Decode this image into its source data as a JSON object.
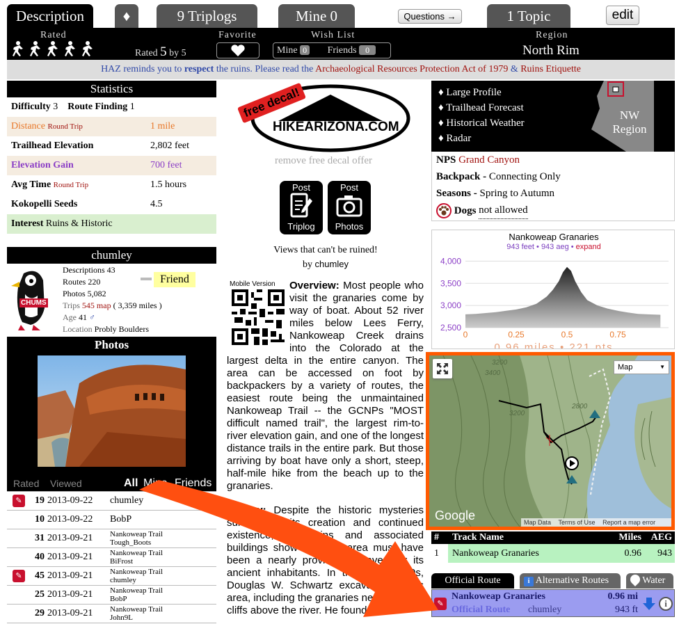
{
  "tabs": {
    "description": "Description",
    "diamond": "♦",
    "triplogs": "9 Triplogs",
    "mine": "Mine 0",
    "questions": "Questions →",
    "topic": "1 Topic",
    "edit": "edit"
  },
  "topbar": {
    "rated_label": "Rated",
    "rated_text": "Rated",
    "rated_value": "5",
    "rated_by": "by 5",
    "favorite_label": "Favorite",
    "wishlist_label": "Wish List",
    "mine_label": "Mine",
    "mine_count": "0",
    "friends_label": "Friends",
    "friends_count": "0",
    "region_label": "Region",
    "region_value": "North Rim"
  },
  "notice": {
    "p1": "HAZ reminds you to ",
    "p2": "respect",
    "p3": " the ruins. Please read the ",
    "p4": "Archaeological Resources Protection Act of 1979",
    "p5": " & ",
    "p6": "Ruins Etiquette"
  },
  "stats": {
    "title": "Statistics",
    "difficulty_label": "Difficulty",
    "difficulty": "3",
    "routefinding_label": "Route Finding",
    "routefinding": "1",
    "distance_label": "Distance",
    "distance_sub": "Round Trip",
    "distance": "1 mile",
    "trailhead_label": "Trailhead Elevation",
    "trailhead": "2,802 feet",
    "gain_label": "Elevation Gain",
    "gain": "700 feet",
    "avgtime_label": "Avg Time",
    "avgtime_sub": "Round Trip",
    "avgtime": "1.5 hours",
    "seeds_label": "Kokopelli Seeds",
    "seeds": "4.5",
    "interest_label": "Interest",
    "interest": "Ruins & Historic"
  },
  "user": {
    "name": "chumley",
    "descriptions": "Descriptions 43",
    "routes": "Routes 220",
    "photos": "Photos 5,082",
    "trips_label": "Trips",
    "trips_count": "545",
    "trips_map": "map",
    "trips_miles": "( 3,359 miles )",
    "age_label": "Age",
    "age": "41",
    "location_label": "Location",
    "location": "Probly Boulders",
    "friend": "Friend",
    "badge": "CHUMS"
  },
  "photos": {
    "title": "Photos"
  },
  "triplist": {
    "rated": "Rated",
    "viewed": "Viewed",
    "all": "All",
    "mine": "Mine",
    "friends": "Friends",
    "rows": [
      {
        "num": "19",
        "date": "2013-09-22",
        "title": "chumley",
        "sub": "",
        "icon": true
      },
      {
        "num": "10",
        "date": "2013-09-22",
        "title": "BobP",
        "sub": "",
        "icon": false
      },
      {
        "num": "31",
        "date": "2013-09-21",
        "title": "Nankoweap Trail",
        "sub": "Tough_Boots",
        "icon": false
      },
      {
        "num": "40",
        "date": "2013-09-21",
        "title": "Nankoweap Trail",
        "sub": "BiFrost",
        "icon": false
      },
      {
        "num": "45",
        "date": "2013-09-21",
        "title": "Nankoweap Trail",
        "sub": "chumley",
        "icon": true
      },
      {
        "num": "25",
        "date": "2013-09-21",
        "title": "Nankoweap Trail",
        "sub": "BobP",
        "icon": false
      },
      {
        "num": "29",
        "date": "2013-09-21",
        "title": "Nankoweap Trail",
        "sub": "John9L",
        "icon": false
      }
    ]
  },
  "decal": {
    "free": "free decal!",
    "site": "HIKEARIZONA.COM",
    "remove": "remove free decal offer"
  },
  "post": {
    "post1": "Post",
    "triplog": "Triplog",
    "post2": "Post",
    "photos": "Photos"
  },
  "tagline": {
    "line": "Views that can't be ruined!",
    "by": "by",
    "author": "chumley"
  },
  "mobile": "Mobile Version",
  "overview": {
    "title": "Overview:",
    "text": "Most people who visit the granaries come by way of boat. About 52 river miles below Lees Ferry, Nankoweap Creek drains into the Colorado at the largest delta in the entire canyon. The area can be accessed on foot by backpackers by a variety of routes, the easiest route being the unmaintained Nankoweap Trail -- the GCNPs \"MOST difficult named trail\", the largest rim-to-river elevation gain, and one of the longest distance trails in the entire park. But those arriving by boat have only a short, steep, half-mile hike from the beach up to the granaries.",
    "history_title": "History:",
    "history_text": "Despite the historic mysteries surrounding its creation and continued existence, the ruins and associated buildings show that this area must have been a nearly provided a haven for its ancient inhabitants. In the early 1900s, Douglas W. Schwartz excavated in this area, including the granaries nestled in the cliffs above the river. He found"
  },
  "links": {
    "items": [
      "Large Profile",
      "Trailhead Forecast",
      "Historical Weather",
      "Radar"
    ],
    "region": "NW Region"
  },
  "info": {
    "nps": "NPS",
    "park": "Grand Canyon",
    "backpack_label": "Backpack -",
    "backpack": "Connecting Only",
    "seasons_label": "Seasons -",
    "seasons": "Spring to Autumn",
    "dogs_label": "Dogs",
    "dogs": "not allowed"
  },
  "profile": {
    "title": "Nankoweap Granaries",
    "sub": "943 feet • 943 aeg •",
    "expand": "expand",
    "yticks": [
      "4,000",
      "3,500",
      "3,000",
      "2,500"
    ],
    "xticks": [
      "0",
      "0.25",
      "0.5",
      "0.75"
    ],
    "footer": "0.96 miles • 221 pts"
  },
  "map": {
    "type": "Map",
    "google": "Google",
    "mapdata": "Map Data",
    "terms": "Terms of Use",
    "report": "Report a map error",
    "labels": [
      "3200",
      "3400",
      "3200",
      "2800"
    ]
  },
  "tracks": {
    "h_num": "#",
    "h_name": "Track Name",
    "h_miles": "Miles",
    "h_aeg": "AEG",
    "rows": [
      {
        "num": "1",
        "name": "Nankoweap Granaries",
        "miles": "0.96",
        "aeg": "943"
      }
    ]
  },
  "routes": {
    "official": "Official Route",
    "alternative": "Alternative Routes",
    "water": "Water",
    "name": "Nankoweap Granaries",
    "type": "Official Route",
    "author": "chumley",
    "miles": "0.96 mi",
    "feet": "943 ft"
  },
  "chart_data": {
    "type": "area",
    "title": "Nankoweap Granaries",
    "xlabel": "",
    "ylabel": "",
    "xlim": [
      0,
      1
    ],
    "ylim": [
      2500,
      4100
    ],
    "x": [
      0,
      0.05,
      0.1,
      0.15,
      0.2,
      0.25,
      0.3,
      0.35,
      0.4,
      0.43,
      0.46,
      0.48,
      0.5,
      0.52,
      0.54,
      0.57,
      0.6,
      0.65,
      0.7,
      0.75,
      0.8,
      0.85,
      0.9,
      0.96
    ],
    "values": [
      2800,
      2810,
      2830,
      2850,
      2880,
      2910,
      2960,
      3040,
      3200,
      3350,
      3550,
      3750,
      3870,
      3780,
      3550,
      3300,
      3120,
      3000,
      2930,
      2880,
      2840,
      2810,
      2800,
      2790
    ]
  }
}
